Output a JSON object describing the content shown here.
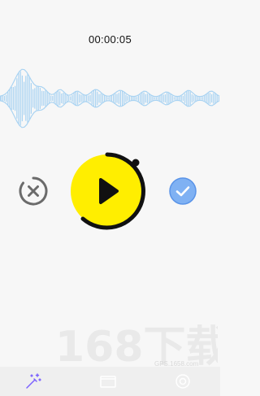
{
  "recorder": {
    "elapsed_time": "00:00:05"
  },
  "controls": {
    "cancel_icon": "close-circle-icon",
    "play_icon": "play-icon",
    "confirm_icon": "check-circle-icon"
  },
  "watermark": {
    "text": "168下载",
    "site": "GPS.1658.com"
  },
  "bottom_nav": {
    "items": [
      {
        "icon": "magic-wand-icon",
        "active": true
      },
      {
        "icon": "folder-icon",
        "active": false
      },
      {
        "icon": "settings-icon",
        "active": false
      }
    ]
  },
  "colors": {
    "accent_yellow": "#ffee00",
    "wave_blue": "#a9d3f2",
    "confirm_blue": "#6aa8f5",
    "active_tab": "#7b61ff"
  }
}
